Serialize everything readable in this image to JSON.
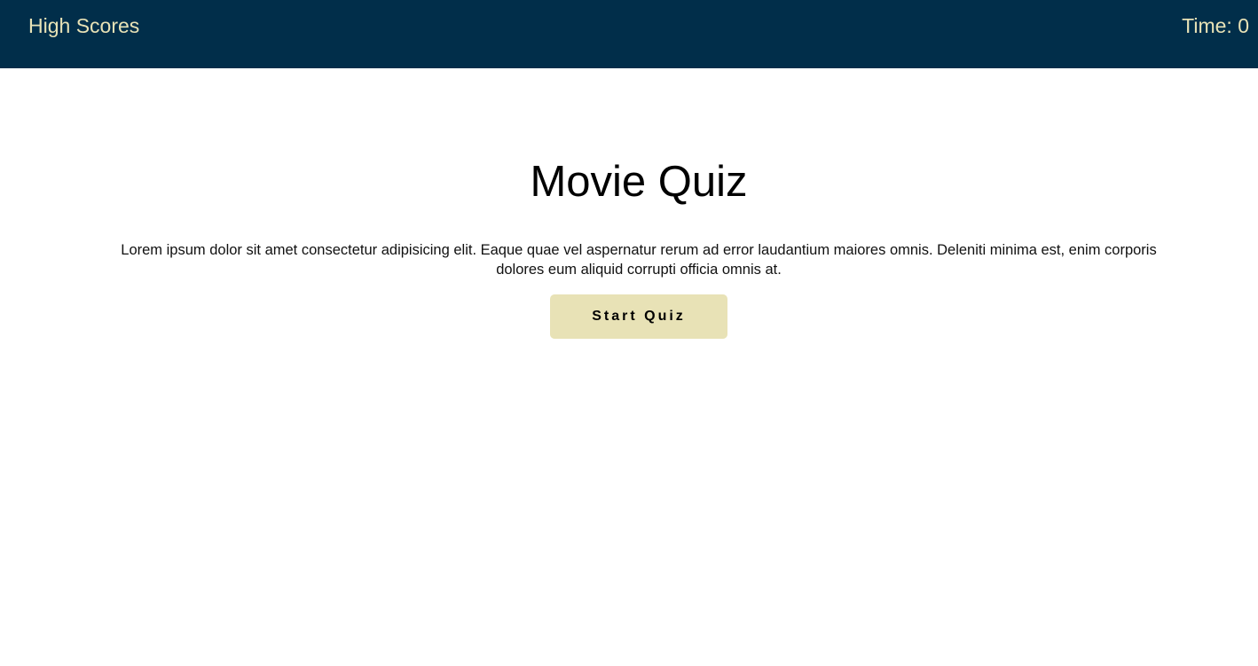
{
  "header": {
    "high_scores_label": "High Scores",
    "timer_label": "Time: ",
    "timer_value": "0"
  },
  "quiz": {
    "title": "Movie Quiz",
    "intro": "Lorem ipsum dolor sit amet consectetur adipisicing elit. Eaque quae vel aspernatur rerum ad error laudantium maiores omnis. Deleniti minima est, enim corporis dolores eum aliquid corrupti officia omnis at.",
    "start_button_label": "Start Quiz"
  },
  "colors": {
    "header_background": "#012e4a",
    "header_text": "#e8e2b6",
    "button_background": "#e8e2b6",
    "page_background": "#ffffff"
  }
}
